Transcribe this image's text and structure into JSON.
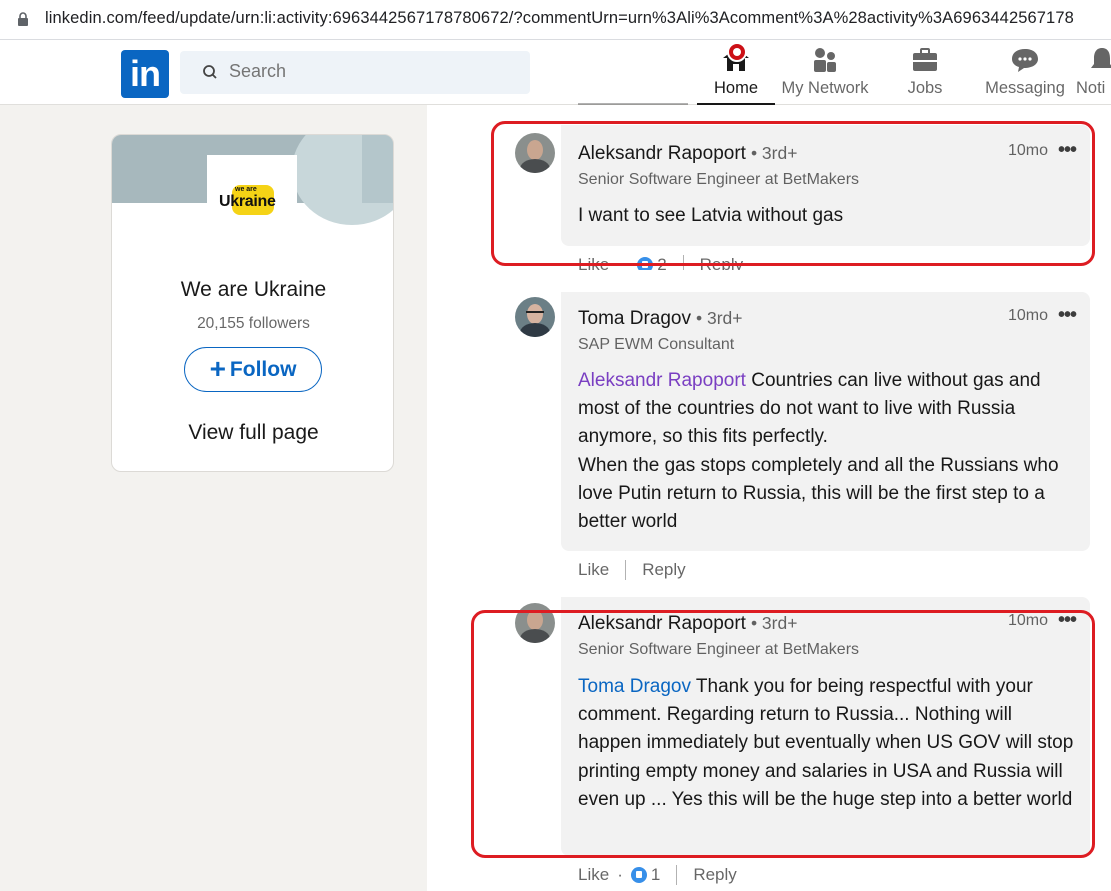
{
  "browser": {
    "url": "linkedin.com/feed/update/urn:li:activity:6963442567178780672/?commentUrn=urn%3Ali%3Acomment%3A%28activity%3A6963442567178"
  },
  "nav": {
    "logo": "in",
    "search_placeholder": "Search",
    "items": [
      {
        "label": "Home",
        "icon": "home-icon",
        "active": true
      },
      {
        "label": "My Network",
        "icon": "people-icon"
      },
      {
        "label": "Jobs",
        "icon": "briefcase-icon"
      },
      {
        "label": "Messaging",
        "icon": "chat-icon"
      },
      {
        "label": "Noti",
        "icon": "bell-icon"
      }
    ]
  },
  "page_card": {
    "logo_small": "we are",
    "logo_big": "Ukraine",
    "name": "We are Ukraine",
    "followers": "20,155 followers",
    "follow_plus": "+",
    "follow_label": "Follow",
    "view_full": "View full page"
  },
  "comments": [
    {
      "author": "Aleksandr Rapoport",
      "degree": "• 3rd+",
      "title": "Senior Software Engineer at BetMakers",
      "time": "10mo",
      "menu": "•••",
      "mention": "",
      "text": "I want to see Latvia without gas",
      "like": "Like",
      "reactions": "2",
      "reply": "Reply"
    },
    {
      "author": "Toma Dragov",
      "degree": "• 3rd+",
      "title": "SAP EWM Consultant",
      "time": "10mo",
      "menu": "•••",
      "mention": "Aleksandr Rapoport",
      "text": " Countries can live without gas and most of the countries do not want to live with Russia anymore, so this fits perfectly.\nWhen the gas stops completely and all the Russians who love Putin return to Russia, this will be the first step to a better world",
      "like": "Like",
      "reply": "Reply"
    },
    {
      "author": "Aleksandr Rapoport",
      "degree": "• 3rd+",
      "title": "Senior Software Engineer at BetMakers",
      "time": "10mo",
      "menu": "•••",
      "mention": "Toma Dragov",
      "text": " Thank you for being respectful with your comment. Regarding return to Russia... Nothing will happen immediately but eventually when US GOV will stop printing empty money and salaries in USA and Russia will even up ... Yes this will be the huge step into a better world",
      "like": "Like",
      "dot": "·",
      "reactions": "1",
      "reply": "Reply"
    }
  ],
  "colors": {
    "linkedin_blue": "#0a66c2",
    "highlight_red": "#dd1c22",
    "visited_mention": "#7a3fc2"
  }
}
